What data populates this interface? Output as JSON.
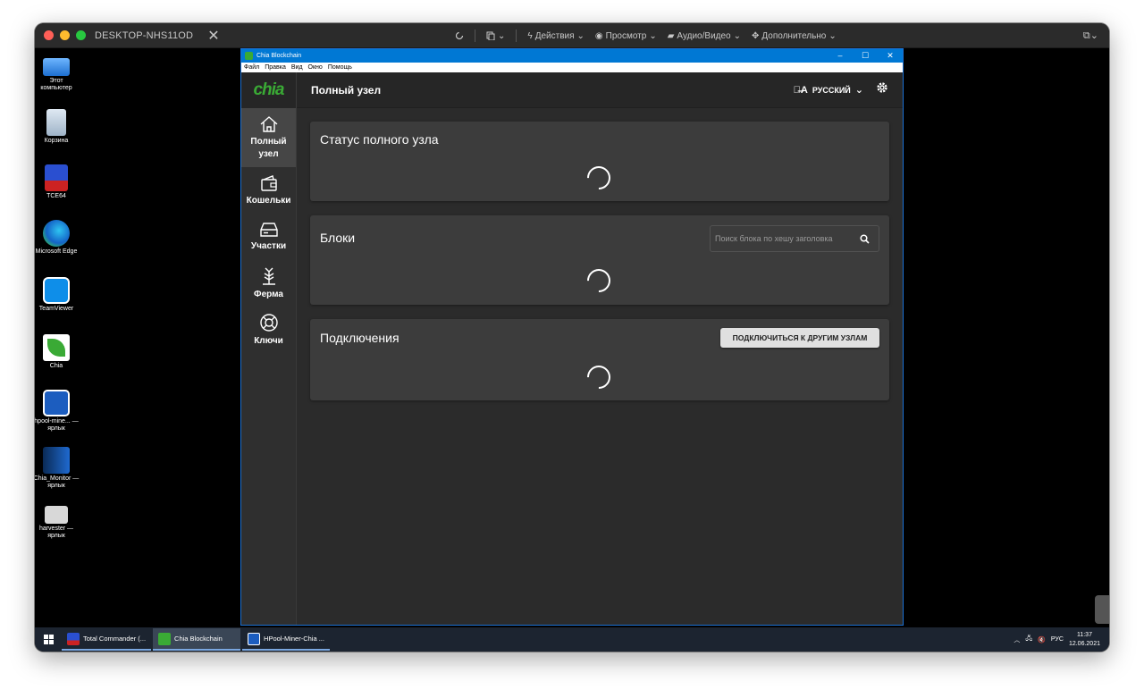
{
  "host": {
    "title": "DESKTOP-NHS11OD",
    "toolbar": {
      "actions": "Действия",
      "view": "Просмотр",
      "av": "Аудио/Видео",
      "more": "Дополнительно"
    }
  },
  "desktop_icons": [
    {
      "label": "Этот компьютер"
    },
    {
      "label": "Корзина"
    },
    {
      "label": "TCE64"
    },
    {
      "label": "Microsoft Edge"
    },
    {
      "label": "TeamViewer"
    },
    {
      "label": "Chia"
    },
    {
      "label": "hpool-mine... — ярлык"
    },
    {
      "label": "Chia_Monitor — ярлык"
    },
    {
      "label": "harvester — ярлык"
    }
  ],
  "app": {
    "window_title": "Chia Blockchain",
    "menu": [
      "Файл",
      "Правка",
      "Вид",
      "Окно",
      "Помощь"
    ],
    "logo": "chia",
    "page_title": "Полный узел",
    "language": "РУССКИЙ",
    "nav": [
      {
        "label": "Полный узел",
        "icon": "home-icon"
      },
      {
        "label": "Кошельки",
        "icon": "wallet-icon"
      },
      {
        "label": "Участки",
        "icon": "storage-icon"
      },
      {
        "label": "Ферма",
        "icon": "sprout-icon"
      },
      {
        "label": "Ключи",
        "icon": "lifebuoy-icon"
      }
    ],
    "cards": {
      "status_title": "Статус полного узла",
      "blocks_title": "Блоки",
      "search_placeholder": "Поиск блока по хешу заголовка",
      "connections_title": "Подключения",
      "connect_button": "ПОДКЛЮЧИТЬСЯ К ДРУГИМ УЗЛАМ"
    }
  },
  "taskbar": {
    "tasks": [
      "Total Commander (...",
      "Chia Blockchain",
      "HPool-Miner-Chia ..."
    ],
    "lang": "РУС",
    "time": "11:37",
    "date": "12.06.2021"
  },
  "colors": {
    "accent": "#3aaa35",
    "titlebar_blue": "#0078d4",
    "card_bg": "#3c3c3c"
  }
}
